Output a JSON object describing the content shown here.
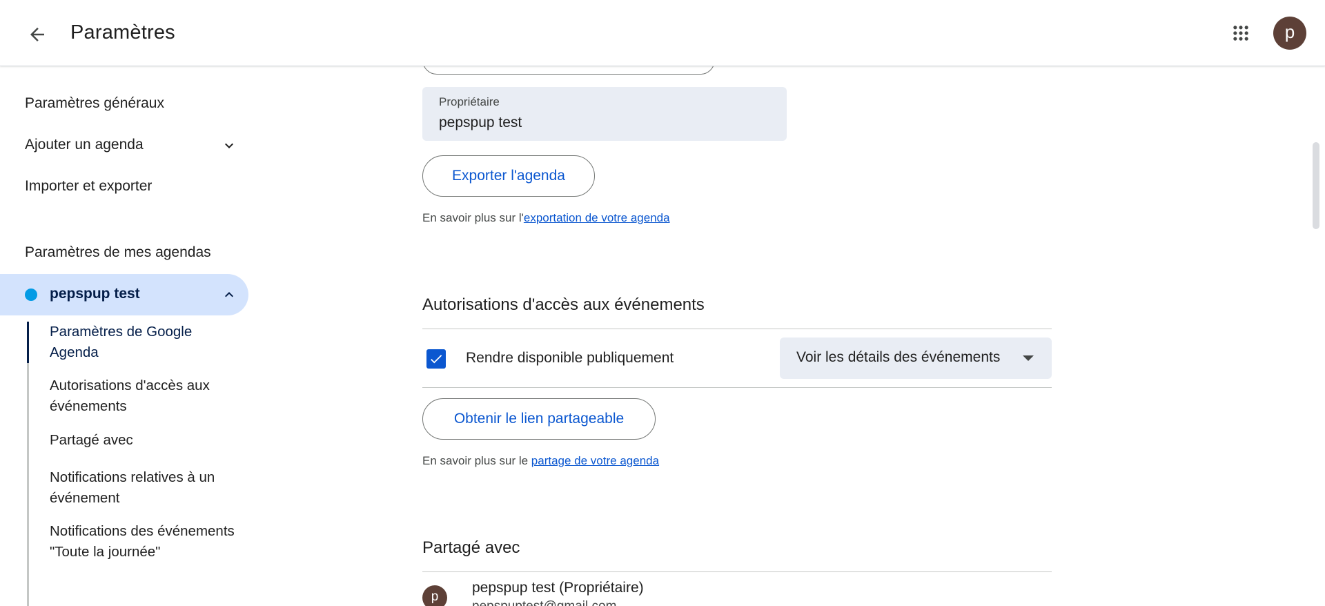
{
  "header": {
    "title": "Paramètres",
    "back_icon": "arrow-back-icon",
    "apps_icon": "apps-grid-icon",
    "avatar_letter": "p",
    "avatar_color": "#5d4037"
  },
  "sidebar": {
    "top_items": [
      {
        "label": "Paramètres généraux"
      },
      {
        "label": "Ajouter un agenda",
        "icon": "chevron-down-icon"
      },
      {
        "label": "Importer et exporter"
      }
    ],
    "section_heading": "Paramètres de mes agendas",
    "calendar": {
      "name": "pepspup test",
      "color": "#039be5",
      "icon": "chevron-up-icon"
    },
    "sub_items": [
      {
        "label": "Paramètres de Google Agenda",
        "active": true
      },
      {
        "label": "Autorisations d'accès aux événements"
      },
      {
        "label": "Partagé avec"
      },
      {
        "label": "Notifications relatives à un événement"
      },
      {
        "label": "Notifications des événements \"Toute la journée\""
      }
    ]
  },
  "main": {
    "owner": {
      "label": "Propriétaire",
      "value": "pepspup test"
    },
    "export_button": "Exporter l'agenda",
    "export_help": {
      "prefix": "En savoir plus sur l'",
      "link": "exportation de votre agenda"
    },
    "permissions": {
      "title": "Autorisations d'accès aux événements",
      "checkbox_label": "Rendre disponible publiquement",
      "checkbox_checked": true,
      "select_value": "Voir les détails des événements",
      "share_button": "Obtenir le lien partageable",
      "help": {
        "prefix": "En savoir plus sur le ",
        "link": "partage de votre agenda"
      }
    },
    "shared_with": {
      "title": "Partagé avec",
      "members": [
        {
          "avatar_letter": "p",
          "name": "pepspup test (Propriétaire)",
          "email": "pepspuptest@gmail.com"
        }
      ]
    }
  },
  "colors": {
    "accent": "#0b57d0",
    "active_nav_bg": "#d3e3fd",
    "field_bg": "#e9edf4"
  }
}
